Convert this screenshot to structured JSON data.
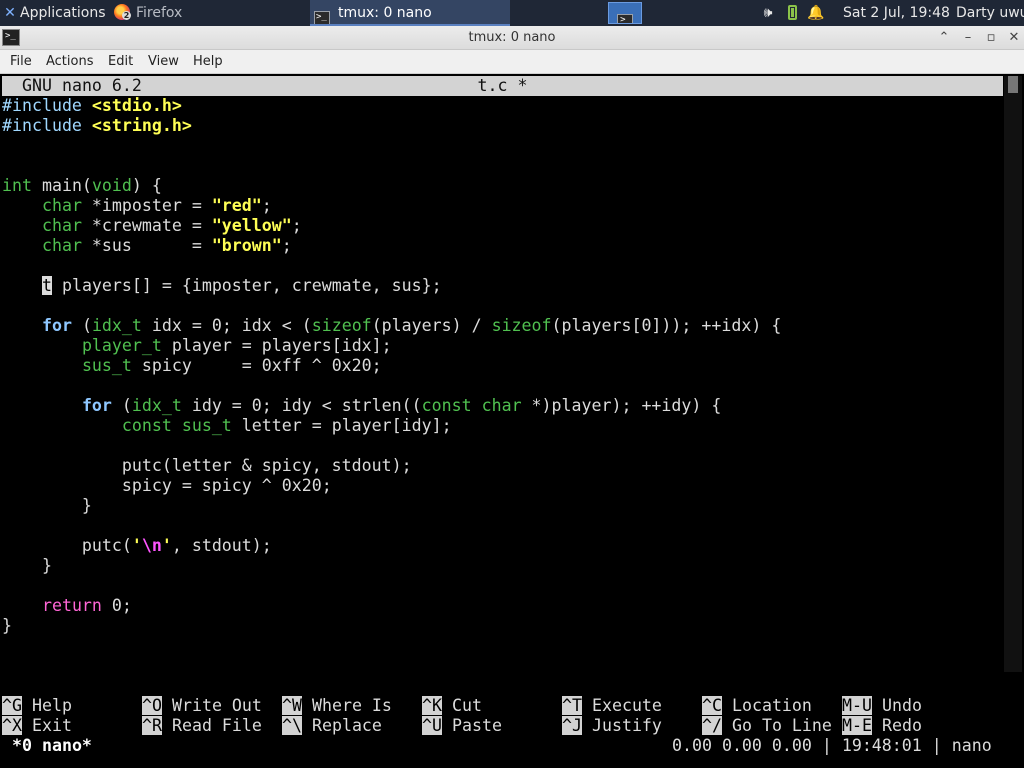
{
  "panel": {
    "applications_label": "Applications",
    "applications_suffix": "≡",
    "firefox_label": "Firefox",
    "firefox_badge": "2",
    "tmux_task_label": "tmux: 0 nano",
    "clock": "Sat  2 Jul, 19:48",
    "user": "Darty uwu"
  },
  "window": {
    "title": "tmux: 0 nano",
    "icon_text": ">_"
  },
  "menu": {
    "file": "File",
    "actions": "Actions",
    "edit": "Edit",
    "view": "View",
    "help": "Help"
  },
  "nano": {
    "version": "GNU nano 6.2",
    "filename": "t.c *"
  },
  "code": {
    "l1": [
      "#include ",
      "<stdio.h>"
    ],
    "l2": [
      "#include ",
      "<string.h>"
    ],
    "l5": [
      "int",
      " main(",
      "void",
      ") {"
    ],
    "l6": [
      "    ",
      "char",
      " *imposter = ",
      "\"red\"",
      ";"
    ],
    "l7": [
      "    ",
      "char",
      " *crewmate = ",
      "\"yellow\"",
      ";"
    ],
    "l8": [
      "    ",
      "char",
      " *sus      = ",
      "\"brown\"",
      ";"
    ],
    "l10": [
      "    ",
      "t",
      " players[] = {imposter, crewmate, sus};"
    ],
    "l12": [
      "    ",
      "for",
      " (",
      "idx_t",
      " idx = 0; idx < (",
      "sizeof",
      "(players) / ",
      "sizeof",
      "(players[0])); ++idx) {"
    ],
    "l13": [
      "        ",
      "player_t",
      " player = players[idx];"
    ],
    "l14": [
      "        ",
      "sus_t",
      " spicy     = 0xff ^ 0x20;"
    ],
    "l16": [
      "        ",
      "for",
      " (",
      "idx_t",
      " idy = 0; idy < strlen((",
      "const",
      " ",
      "char",
      " *)player); ++idy) {"
    ],
    "l17": [
      "            ",
      "const",
      " ",
      "sus_t",
      " letter = player[idy];"
    ],
    "l19": [
      "            putc(letter & spicy, stdout);"
    ],
    "l20": [
      "            spicy = spicy ^ 0x20;"
    ],
    "l21": [
      "        }"
    ],
    "l23": [
      "        putc(",
      "'",
      "\\n",
      "'",
      ", stdout);"
    ],
    "l24": [
      "    }"
    ],
    "l26": [
      "    ",
      "return",
      " 0;"
    ],
    "l27": [
      "}"
    ]
  },
  "shortcuts": {
    "row1": [
      {
        "key": "^G",
        "label": "Help"
      },
      {
        "key": "^O",
        "label": "Write Out"
      },
      {
        "key": "^W",
        "label": "Where Is"
      },
      {
        "key": "^K",
        "label": "Cut"
      },
      {
        "key": "^T",
        "label": "Execute"
      },
      {
        "key": "^C",
        "label": "Location"
      },
      {
        "key": "M-U",
        "label": "Undo"
      }
    ],
    "row2": [
      {
        "key": "^X",
        "label": "Exit"
      },
      {
        "key": "^R",
        "label": "Read File"
      },
      {
        "key": "^\\",
        "label": "Replace"
      },
      {
        "key": "^U",
        "label": "Paste"
      },
      {
        "key": "^J",
        "label": "Justify"
      },
      {
        "key": "^/",
        "label": "Go To Line"
      },
      {
        "key": "M-E",
        "label": "Redo"
      }
    ]
  },
  "tmux": {
    "window": "*0 nano*",
    "status_right": "0.00 0.00 0.00 | 19:48:01 | nano"
  },
  "colors": {
    "panel_bg": "#1f2736",
    "preprocessor": "#a0d8ff",
    "string": "#ffff55",
    "type": "#50c050",
    "keyword": "#ff6fdf",
    "header_bg": "#d3d3d3"
  }
}
